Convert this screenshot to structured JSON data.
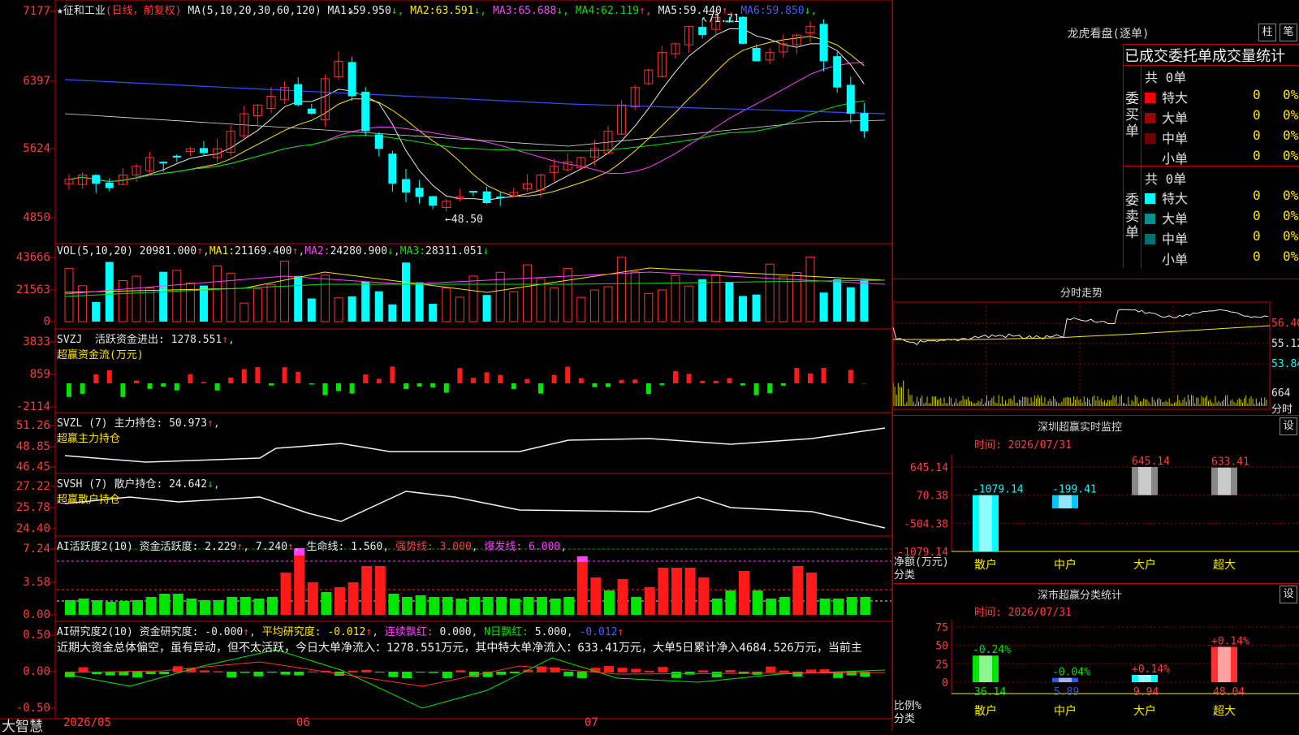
{
  "header": {
    "price_top": "7177",
    "stock_name": "★征和工业",
    "mode": "(日线，前复权)",
    "ma_label": "MA(5,10,20,30,60,120)",
    "ma_values": [
      {
        "label": "MA1:",
        "value": "59.950",
        "arrow": "↓",
        "color": "#e8e8e8"
      },
      {
        "label": "MA2:",
        "value": "63.591",
        "arrow": "↓",
        "color": "#ffe600"
      },
      {
        "label": "MA3:",
        "value": "65.688",
        "arrow": "↓",
        "color": "#ff40ff"
      },
      {
        "label": "MA4:",
        "value": "62.119",
        "arrow": "↑",
        "color": "#00e600"
      },
      {
        "label": "MA5:",
        "value": "59.440",
        "arrow": "↑",
        "color": "#e8e8e8"
      },
      {
        "label": "MA6:",
        "value": "59.850",
        "arrow": "↓",
        "color": "#4060ff"
      }
    ]
  },
  "main_axis": {
    "labels": [
      "7177",
      "6397",
      "5624",
      "4850"
    ],
    "high_note": "71.71",
    "low_note": "←48.50",
    "star": "*"
  },
  "vol": {
    "axis": [
      "43666",
      "21563",
      "0"
    ],
    "title": "VOL(5,10,20)",
    "value": "20981.000",
    "ma1": "21169.400",
    "ma2": "24280.900",
    "ma3": "28311.051",
    "ma1_label": "MA1:",
    "ma2_label": "MA2:",
    "ma3_label": "MA3:"
  },
  "svzj": {
    "axis": [
      "3833",
      "859",
      "-2114"
    ],
    "title": "SVZJ",
    "label": "活跃资金进出:",
    "value": "1278.551",
    "sub": "超赢资金流(万元)"
  },
  "svzl": {
    "axis": [
      "51.26",
      "48.85",
      "46.45"
    ],
    "title": "SVZL (7)",
    "label": "主力持仓:",
    "value": "50.973",
    "sub": "超赢主力持仓"
  },
  "svsh": {
    "axis": [
      "27.22",
      "25.78",
      "24.40"
    ],
    "title": "SVSH (7)",
    "label": "散户持仓:",
    "value": "24.642",
    "sub": "超赢散户持仓"
  },
  "ai_active": {
    "axis": [
      "7.24",
      "3.58",
      "0.00"
    ],
    "title": "AI活跃度2(10)",
    "fund_label": "资金活跃度:",
    "fund_value": "2.229",
    "v2": "7.240",
    "life_label": "生命线:",
    "life_value": "1.560",
    "strong_label": "强势线:",
    "strong_value": "3.000",
    "burst_label": "爆发线:",
    "burst_value": "6.000"
  },
  "ai_research": {
    "axis": [
      "0.50",
      "0.00",
      "-0.50"
    ],
    "title": "AI研究度2(10)",
    "r_label": "资金研究度:",
    "r_value": "-0.000",
    "avg_label": "平均研究度:",
    "avg_value": "-0.012",
    "red_label": "连续飘红:",
    "red_value": "0.000",
    "n_label": "N日飘红:",
    "n_value": "5.000",
    "last_value": "-0.012",
    "comment": "近期大资金总体偏空，虽有异动，但不太活跃，今日大单净流入：1278.551万元，其中特大单净流入：633.41万元，大单5日累计净入4684.526万元，当前主"
  },
  "bottom": {
    "brand": "大智慧",
    "date_start": "2026/05",
    "m06": "06",
    "m07": "07"
  },
  "dragon": {
    "title": "龙虎看盘(逐单)",
    "btn1": "柱",
    "btn2": "笔",
    "subtitle": "已成交委托单成交量统计",
    "buy_side": "委买单",
    "sell_side": "委卖单",
    "buy_total": "共 0单",
    "sell_total": "共 0单",
    "buy_rows": [
      {
        "label": "特大",
        "count": "0",
        "pct": "0%",
        "color": "#ff0000"
      },
      {
        "label": "大单",
        "count": "0",
        "pct": "0%",
        "color": "#a00000"
      },
      {
        "label": "中单",
        "count": "0",
        "pct": "0%",
        "color": "#700000"
      },
      {
        "label": "小单",
        "count": "0",
        "pct": "0%",
        "color": "#000000"
      }
    ],
    "sell_rows": [
      {
        "label": "特大",
        "count": "0",
        "pct": "0%",
        "color": "#00ffff"
      },
      {
        "label": "大单",
        "count": "0",
        "pct": "0%",
        "color": "#009090"
      },
      {
        "label": "中单",
        "count": "0",
        "pct": "0%",
        "color": "#007070"
      },
      {
        "label": "小单",
        "count": "0",
        "pct": "0%",
        "color": "#000000"
      }
    ]
  },
  "intraday": {
    "title": "分时走势",
    "prices": [
      "56.40",
      "55.12",
      "53.84"
    ],
    "vol": "664",
    "vol_label": "分时"
  },
  "sz_monitor": {
    "title": "深圳超赢实时监控",
    "btn": "设",
    "time": "时间: 2026/07/31",
    "axis": [
      "645.14",
      "70.38",
      "-504.38",
      "-1079.14"
    ],
    "y_label": "净额(万元)",
    "x_label": "分类",
    "cats": [
      "散户",
      "中户",
      "大户",
      "超大"
    ]
  },
  "sz_class": {
    "title": "深市超赢分类统计",
    "btn": "设",
    "time": "时间: 2026/07/31",
    "axis": [
      "75",
      "50",
      "25",
      "0"
    ],
    "y_label": "比例%",
    "x_label": "分类",
    "cats": [
      "散户",
      "中户",
      "大户",
      "超大"
    ]
  },
  "chart_data": [
    {
      "type": "bar",
      "title": "深圳超赢实时监控",
      "ylabel": "净额(万元)",
      "xlabel": "分类",
      "categories": [
        "散户",
        "中户",
        "大户",
        "超大"
      ],
      "values": [
        -1079.14,
        -199.41,
        645.14,
        633.41
      ],
      "value_labels": [
        "-1079.14",
        "-199.41",
        "645.14",
        "633.41"
      ],
      "ylim": [
        -1079.14,
        645.14
      ]
    },
    {
      "type": "bar",
      "title": "深市超赢分类统计",
      "ylabel": "比例%",
      "xlabel": "分类",
      "categories": [
        "散户",
        "中户",
        "大户",
        "超大"
      ],
      "values": [
        36.14,
        5.89,
        9.94,
        48.04
      ],
      "value_labels": [
        "36.14",
        "5.89",
        "9.94",
        "48.04"
      ],
      "change_labels": [
        "-0.24%",
        "-0.04%",
        "+0.14%",
        "+0.14%"
      ],
      "ylim": [
        0,
        75
      ]
    }
  ]
}
